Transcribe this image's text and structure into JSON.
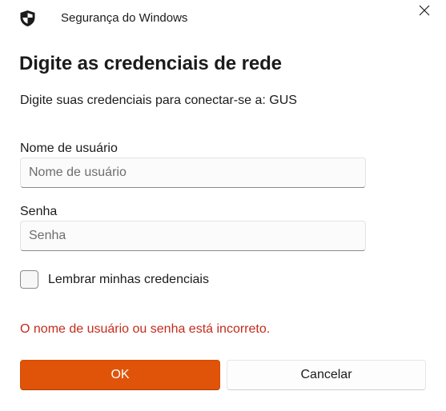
{
  "window": {
    "app_title": "Segurança do Windows",
    "shield_icon": "windows-security-shield-icon",
    "close_icon": "close-icon"
  },
  "dialog": {
    "heading": "Digite as credenciais de rede",
    "subheading": "Digite suas credenciais para conectar-se a: GUS"
  },
  "username": {
    "label": "Nome de usuário",
    "value": "",
    "placeholder": "Nome de usuário"
  },
  "password": {
    "label": "Senha",
    "value": "",
    "placeholder": "Senha"
  },
  "remember": {
    "label": "Lembrar minhas credenciais",
    "checked": false
  },
  "error": {
    "message": "O nome de usuário ou senha está incorreto.",
    "color": "#c42b1c"
  },
  "buttons": {
    "ok_label": "OK",
    "cancel_label": "Cancelar"
  },
  "colors": {
    "accent": "#e0540a",
    "accent_text": "#ffffff"
  }
}
